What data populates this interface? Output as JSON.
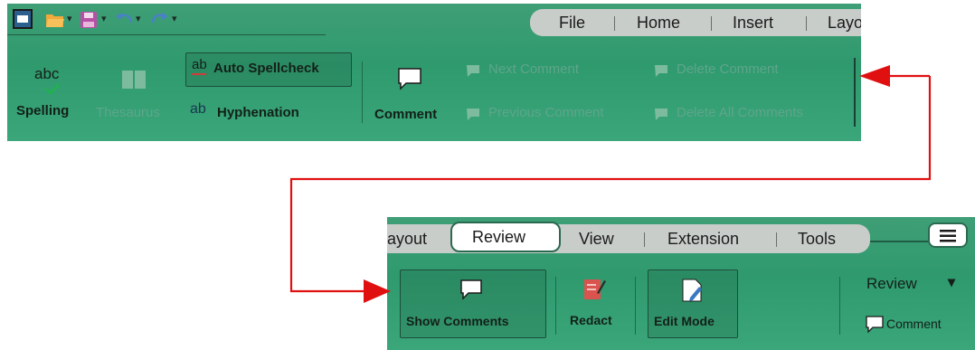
{
  "top_panel": {
    "tabs": [
      "File",
      "Home",
      "Insert",
      "Layo"
    ],
    "spelling": {
      "icon_text": "abc",
      "label": "Spelling"
    },
    "thesaurus": {
      "label": "Thesaurus"
    },
    "auto_spellcheck": {
      "icon_text": "ab",
      "label": "Auto Spellcheck"
    },
    "hyphenation": {
      "icon_text": "ab",
      "label": "Hyphenation"
    },
    "comment": {
      "label": "Comment"
    },
    "next_comment": {
      "label": "Next Comment"
    },
    "previous_comment": {
      "label": "Previous Comment"
    },
    "delete_comment": {
      "label": "Delete Comment"
    },
    "delete_all_comments": {
      "label": "Delete All Comments"
    }
  },
  "bottom_panel": {
    "tabs": [
      "ayout",
      "Review",
      "View",
      "Extension",
      "Tools"
    ],
    "active_tab": "Review",
    "show_comments": {
      "label": "Show Comments"
    },
    "redact": {
      "label": "Redact"
    },
    "edit_mode": {
      "label": "Edit Mode"
    },
    "review_dropdown": {
      "label": "Review",
      "arrow": "▾"
    },
    "comment": {
      "label": "Comment"
    }
  },
  "colors": {
    "arrow": "#e01010",
    "panel": "#35a072",
    "tabbar": "#c9cdca"
  },
  "icons": [
    "window-icon",
    "folder-open-icon",
    "save-icon",
    "undo-icon",
    "redo-icon",
    "menu-icon",
    "comment-icon",
    "redact-icon",
    "edit-mode-icon"
  ]
}
